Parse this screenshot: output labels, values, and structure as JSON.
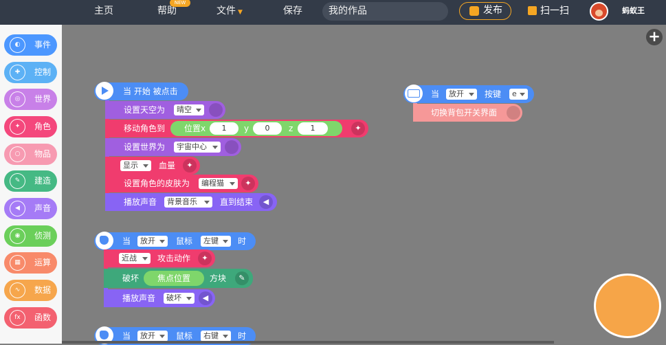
{
  "topbar": {
    "home": "主页",
    "help": "帮助",
    "new_badge": "NEW",
    "file": "文件",
    "save": "保存",
    "project_name": "我的作品",
    "publish": "发布",
    "scan": "扫一扫",
    "username": "蚂蚁王"
  },
  "sidebar": {
    "items": [
      {
        "label": "事件",
        "color": "#4c97ff",
        "icon": "toggle-icon"
      },
      {
        "label": "控制",
        "color": "#5cb1f5",
        "icon": "gamepad-icon"
      },
      {
        "label": "世界",
        "color": "#c880e8",
        "icon": "globe-icon"
      },
      {
        "label": "角色",
        "color": "#f4477c",
        "icon": "runner-icon"
      },
      {
        "label": "物品",
        "color": "#f79ab1",
        "icon": "bulb-icon"
      },
      {
        "label": "建造",
        "color": "#45b984",
        "icon": "wrench-icon"
      },
      {
        "label": "声音",
        "color": "#a57bf6",
        "icon": "speaker-icon"
      },
      {
        "label": "侦测",
        "color": "#6bcf5a",
        "icon": "radar-icon"
      },
      {
        "label": "运算",
        "color": "#f88a6a",
        "icon": "calculator-icon"
      },
      {
        "label": "数据",
        "color": "#f6a64c",
        "icon": "chart-icon"
      },
      {
        "label": "函数",
        "color": "#f36170",
        "icon": "fx-icon"
      }
    ]
  },
  "scripts": {
    "s1": {
      "hat": "当 开始 被点击",
      "sky_label": "设置天空为",
      "sky_value": "晴空",
      "move_label": "移动角色到",
      "pos_label": "位置x",
      "x_value": "1",
      "y_label": "y",
      "y_value": "0",
      "z_label": "z",
      "z_value": "1",
      "world_label": "设置世界为",
      "world_value": "宇宙中心",
      "show_value": "显示",
      "health_label": "血量",
      "skin_label": "设置角色的皮肤为",
      "skin_value": "编程猫",
      "play_label": "播放声音",
      "play_value": "背景音乐",
      "play_until": "直到结束"
    },
    "s2": {
      "when": "当",
      "action": "放开",
      "mouse": "鼠标",
      "button": "左键",
      "time": "时",
      "melee": "近战",
      "attack": "攻击动作",
      "destroy": "破坏",
      "focus": "焦点位置",
      "block": "方块",
      "play_label": "播放声音",
      "play_value": "破坏"
    },
    "s3": {
      "when": "当",
      "action": "放开",
      "mouse": "鼠标",
      "button": "右键",
      "time": "时"
    },
    "s4": {
      "when": "当",
      "action": "放开",
      "key_label": "按键",
      "key_value": "e",
      "toggle_label": "切换背包开关界面"
    }
  }
}
